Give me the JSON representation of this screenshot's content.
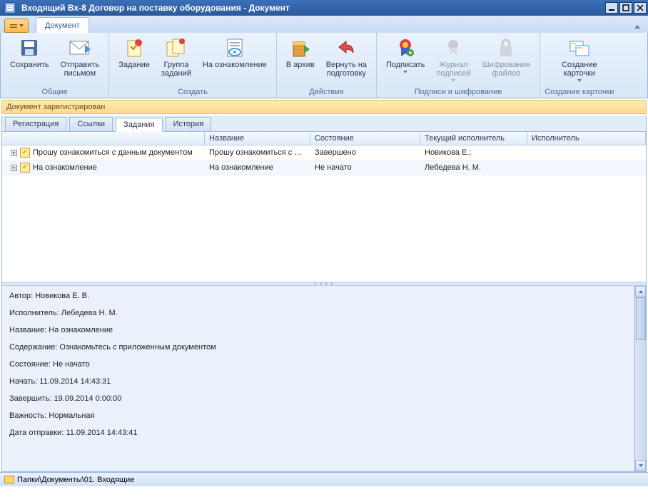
{
  "window": {
    "title": "Входящий Вх-8 Договор на поставку оборудования - Документ"
  },
  "qa": {
    "tab": "Документ"
  },
  "ribbon": {
    "groups": {
      "common": {
        "label": "Общие",
        "save": "Сохранить",
        "send_mail_l1": "Отправить",
        "send_mail_l2": "письмом"
      },
      "create": {
        "label": "Создать",
        "task": "Задание",
        "task_group_l1": "Группа",
        "task_group_l2": "заданий",
        "review": "На ознакомление"
      },
      "actions": {
        "label": "Действия",
        "archive": "В архив",
        "return_l1": "Вернуть на",
        "return_l2": "подготовку"
      },
      "sign": {
        "label": "Подписи и шифрование",
        "sign": "Подписать",
        "journal_l1": "Журнал",
        "journal_l2": "подписей",
        "encrypt_l1": "Шифрование",
        "encrypt_l2": "файлов"
      },
      "card": {
        "label": "Создание карточки",
        "create_card_l1": "Создание",
        "create_card_l2": "карточки"
      }
    }
  },
  "status_strip": "Документ зарегистрирован",
  "tabs": [
    "Регистрация",
    "Ссылки",
    "Задания",
    "История"
  ],
  "active_tab": 2,
  "grid": {
    "columns": [
      "",
      "Название",
      "Состояние",
      "Текущий исполнитель",
      "Исполнитель"
    ],
    "rows": [
      {
        "title": "Прошу ознакомиться с данным документом",
        "name": "Прошу ознакомиться с да...",
        "state": "Завершено",
        "current": "Новикова Е.;",
        "exec": ""
      },
      {
        "title": "На ознакомление",
        "name": "На ознакомление",
        "state": "Не начато",
        "current": "Лебедева Н. М.",
        "exec": ""
      }
    ]
  },
  "detail": {
    "author": "Автор: Новикова Е. В.",
    "executor": "Исполнитель: Лебедева Н. М.",
    "name": "Название: На ознакомление",
    "content": "Содержание: Ознакомьтесь с приложенным документом",
    "state": "Состояние: Не начато",
    "start": "Начать: 11.09.2014 14:43:31",
    "finish": "Завершить: 19.09.2014 0:00:00",
    "importance": "Важность: Нормальная",
    "sent": "Дата отправки: 11.09.2014 14:43:41"
  },
  "footer": {
    "path": "Папки\\Документы\\01. Входящие"
  }
}
